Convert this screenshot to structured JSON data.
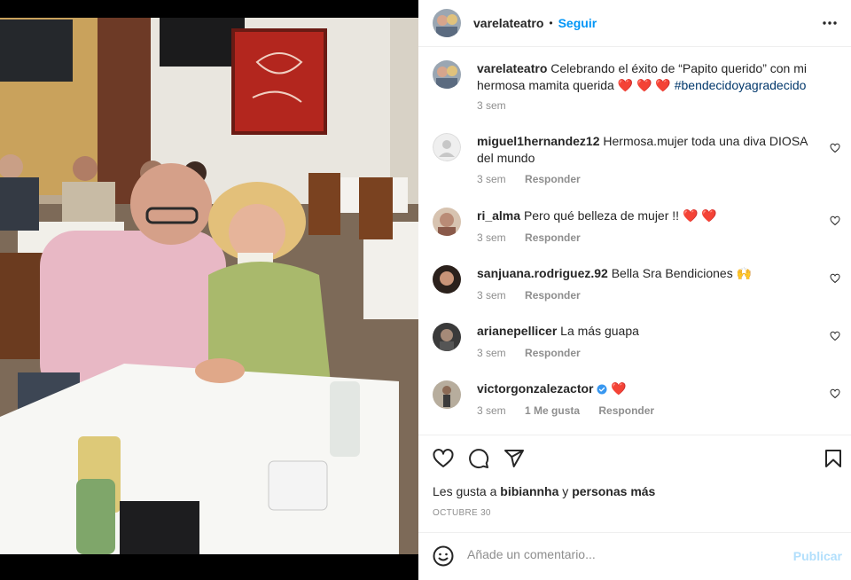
{
  "header": {
    "username": "varelateatro",
    "separator": "•",
    "follow_label": "Seguir",
    "more_icon": "more-horizontal-icon"
  },
  "caption": {
    "username": "varelateatro",
    "text": "Celebrando el éxito de “Papito querido” con mi hermosa mamita querida",
    "hearts": "❤️ ❤️ ❤️",
    "hashtag": "#bendecidoyagradecido",
    "time": "3 sem"
  },
  "comments": [
    {
      "username": "miguel1hernandez12",
      "text": "Hermosa.mujer toda una diva DIOSA del mundo",
      "time": "3 sem",
      "reply": "Responder",
      "likes": ""
    },
    {
      "username": "ri_alma",
      "text": "Pero qué belleza de mujer !!",
      "emoji": "❤️ ❤️",
      "time": "3 sem",
      "reply": "Responder",
      "likes": ""
    },
    {
      "username": "sanjuana.rodriguez.92",
      "text": "Bella Sra Bendiciones",
      "emoji": "🙌",
      "time": "3 sem",
      "reply": "Responder",
      "likes": ""
    },
    {
      "username": "arianepellicer",
      "text": "La más guapa",
      "time": "3 sem",
      "reply": "Responder",
      "likes": ""
    },
    {
      "username": "victorgonzalezactor",
      "text": "",
      "emoji": "❤️",
      "verified": true,
      "time": "3 sem",
      "reply": "Responder",
      "likes": "1 Me gusta"
    }
  ],
  "actions": {
    "like_icon": "heart-icon",
    "comment_icon": "comment-icon",
    "share_icon": "share-icon",
    "save_icon": "bookmark-icon"
  },
  "likes": {
    "prefix": "Les gusta a",
    "user": "bibiannha",
    "joiner": "y",
    "others": "personas más"
  },
  "date": "OCTUBRE 30",
  "add_comment": {
    "placeholder": "Añade un comentario...",
    "publish_label": "Publicar",
    "emoji_icon": "smiley-icon"
  },
  "colors": {
    "accent": "#0095f6",
    "publish_disabled": "#b2dffc",
    "heart": "#ed4956",
    "hashtag": "#00376b",
    "muted": "#8e8e8e",
    "verified": "#3897f0"
  }
}
